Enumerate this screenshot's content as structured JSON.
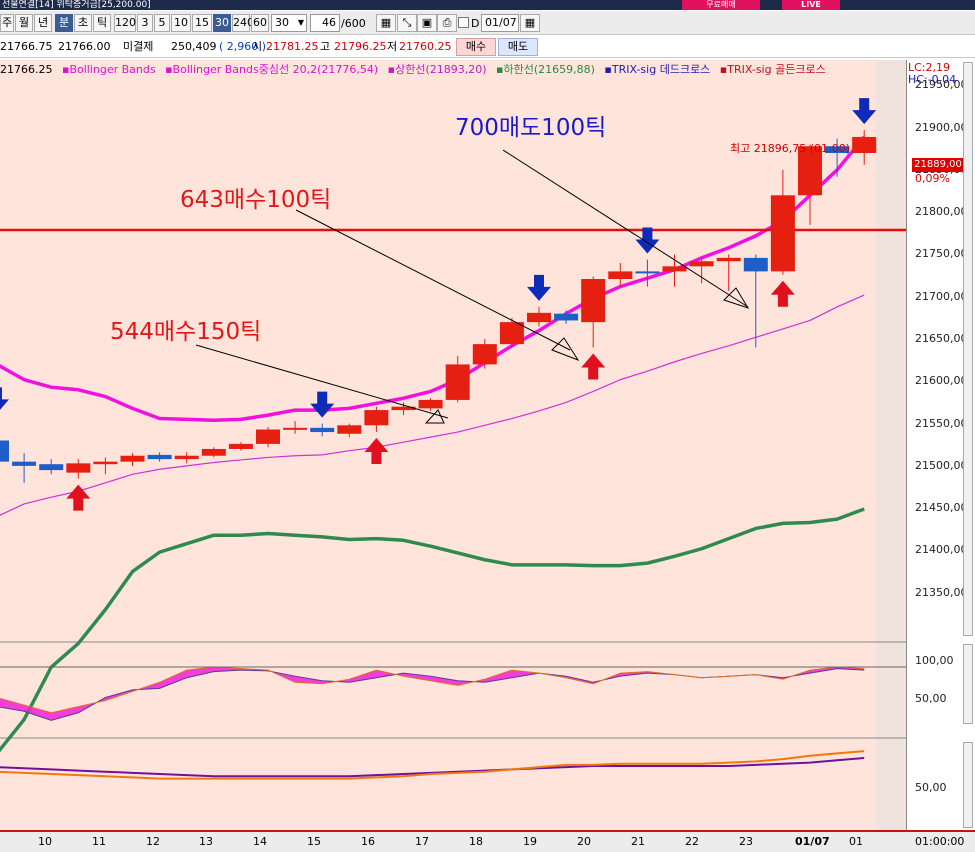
{
  "window": {
    "title": "선물연결[14] 위탁증거금[25,200.00]",
    "badge_buy": "무료매매",
    "badge_live": "LIVE"
  },
  "toolbar": {
    "periods": [
      "주",
      "월",
      "년",
      "분",
      "초",
      "틱"
    ],
    "selected_period": "분",
    "intervals": [
      "120",
      "3",
      "5",
      "10",
      "15",
      "30",
      "240",
      "60"
    ],
    "selected_interval": "30",
    "interval_value": "30",
    "count_value": "46",
    "count_total": "/600",
    "date_value": "01/07"
  },
  "quote": {
    "close": "21766.75",
    "bid": "21766.00",
    "oi_label": "미결제",
    "oi_value": "250,409",
    "oi_change": "( 2,960 )",
    "open_label": "시",
    "open": "21781.25",
    "high_label": "고",
    "high": "21796.25",
    "low_label": "저",
    "low": "21760.25",
    "buy_button": "매수",
    "sell_button": "매도"
  },
  "legend": {
    "value": "21766.25",
    "items": [
      {
        "text": "Bollinger Bands",
        "color": "#e010d0"
      },
      {
        "text": "Bollinger Bands중심선 20,2(21776,54)",
        "color": "#e010d0"
      },
      {
        "text": "상한선(21893,20)",
        "color": "#c020c0"
      },
      {
        "text": "하한선(21659,88)",
        "color": "#2a8a40"
      },
      {
        "text": "TRIX-sig 데드크로스",
        "color": "#1c1cb0"
      },
      {
        "text": "TRIX-sig 골든크로스",
        "color": "#c01020"
      }
    ]
  },
  "right_axis": {
    "lc": "LC:2,19",
    "hc": "HC:-0,04",
    "ticks": [
      "21950,00",
      "21900,00",
      "21850,00",
      "21800,00",
      "21750,00",
      "21700,00",
      "21650,00",
      "21600,00",
      "21550,00",
      "21500,00",
      "21450,00",
      "21400,00",
      "21350,00"
    ],
    "current_price": "21889,00",
    "current_change": "0,09%",
    "sub1_ticks": [
      "100,00",
      "50,00"
    ],
    "sub2_ticks": [
      "50,00"
    ]
  },
  "high_note": "최고 21896,75 (01:00)",
  "annotations": [
    {
      "text": "700매도100틱",
      "color": "#1a1ac8"
    },
    {
      "text": "643매수100틱",
      "color": "#e01818"
    },
    {
      "text": "544매수150틱",
      "color": "#e01818"
    }
  ],
  "x_axis": {
    "labels": [
      "10",
      "11",
      "12",
      "13",
      "14",
      "15",
      "16",
      "17",
      "18",
      "19",
      "20",
      "21",
      "22",
      "23",
      "01/07",
      "01"
    ],
    "time": "01:00:00"
  },
  "chart_data": {
    "type": "candlestick",
    "y_unit": "points",
    "ylim": [
      21300,
      21980
    ],
    "horizontal_line": 21779,
    "candles": [
      {
        "o": 21530,
        "h": 21555,
        "l": 21500,
        "c": 21505,
        "dir": "down"
      },
      {
        "o": 21505,
        "h": 21515,
        "l": 21480,
        "c": 21500,
        "dir": "down"
      },
      {
        "o": 21502,
        "h": 21508,
        "l": 21490,
        "c": 21495,
        "dir": "down"
      },
      {
        "o": 21492,
        "h": 21508,
        "l": 21485,
        "c": 21503,
        "dir": "up"
      },
      {
        "o": 21502,
        "h": 21510,
        "l": 21490,
        "c": 21505,
        "dir": "up"
      },
      {
        "o": 21505,
        "h": 21515,
        "l": 21500,
        "c": 21512,
        "dir": "up"
      },
      {
        "o": 21513,
        "h": 21516,
        "l": 21505,
        "c": 21508,
        "dir": "down"
      },
      {
        "o": 21508,
        "h": 21516,
        "l": 21503,
        "c": 21512,
        "dir": "up"
      },
      {
        "o": 21512,
        "h": 21522,
        "l": 21510,
        "c": 21520,
        "dir": "up"
      },
      {
        "o": 21520,
        "h": 21528,
        "l": 21518,
        "c": 21526,
        "dir": "up"
      },
      {
        "o": 21526,
        "h": 21546,
        "l": 21522,
        "c": 21543,
        "dir": "up"
      },
      {
        "o": 21543,
        "h": 21553,
        "l": 21538,
        "c": 21545,
        "dir": "up"
      },
      {
        "o": 21545,
        "h": 21550,
        "l": 21535,
        "c": 21540,
        "dir": "down"
      },
      {
        "o": 21538,
        "h": 21550,
        "l": 21534,
        "c": 21548,
        "dir": "up"
      },
      {
        "o": 21548,
        "h": 21570,
        "l": 21540,
        "c": 21566,
        "dir": "up"
      },
      {
        "o": 21566,
        "h": 21575,
        "l": 21560,
        "c": 21570,
        "dir": "up"
      },
      {
        "o": 21568,
        "h": 21580,
        "l": 21565,
        "c": 21578,
        "dir": "up"
      },
      {
        "o": 21578,
        "h": 21630,
        "l": 21575,
        "c": 21620,
        "dir": "up"
      },
      {
        "o": 21620,
        "h": 21650,
        "l": 21615,
        "c": 21644,
        "dir": "up"
      },
      {
        "o": 21644,
        "h": 21675,
        "l": 21640,
        "c": 21670,
        "dir": "up"
      },
      {
        "o": 21670,
        "h": 21688,
        "l": 21665,
        "c": 21681,
        "dir": "up"
      },
      {
        "o": 21680,
        "h": 21684,
        "l": 21668,
        "c": 21672,
        "dir": "down"
      },
      {
        "o": 21670,
        "h": 21724,
        "l": 21640,
        "c": 21721,
        "dir": "up"
      },
      {
        "o": 21721,
        "h": 21740,
        "l": 21712,
        "c": 21730,
        "dir": "up"
      },
      {
        "o": 21730,
        "h": 21744,
        "l": 21712,
        "c": 21728,
        "dir": "down"
      },
      {
        "o": 21730,
        "h": 21750,
        "l": 21712,
        "c": 21736,
        "dir": "up"
      },
      {
        "o": 21736,
        "h": 21744,
        "l": 21716,
        "c": 21742,
        "dir": "up"
      },
      {
        "o": 21742,
        "h": 21750,
        "l": 21707,
        "c": 21746,
        "dir": "up"
      },
      {
        "o": 21746,
        "h": 21750,
        "l": 21640,
        "c": 21730,
        "dir": "down"
      },
      {
        "o": 21730,
        "h": 21850,
        "l": 21726,
        "c": 21820,
        "dir": "up"
      },
      {
        "o": 21820,
        "h": 21880,
        "l": 21785,
        "c": 21878,
        "dir": "up"
      },
      {
        "o": 21878,
        "h": 21887,
        "l": 21842,
        "c": 21870,
        "dir": "down"
      },
      {
        "o": 21870,
        "h": 21897,
        "l": 21856,
        "c": 21889,
        "dir": "up"
      }
    ],
    "signals": [
      {
        "bar": 0,
        "type": "sell"
      },
      {
        "bar": 3,
        "type": "buy"
      },
      {
        "bar": 12,
        "type": "sell"
      },
      {
        "bar": 14,
        "type": "buy"
      },
      {
        "bar": 20,
        "type": "sell"
      },
      {
        "bar": 22,
        "type": "buy"
      },
      {
        "bar": 24,
        "type": "sell"
      },
      {
        "bar": 29,
        "type": "buy"
      },
      {
        "bar": 32,
        "type": "sell"
      }
    ],
    "bb_mid": [
      21620,
      21602,
      21593,
      21590,
      21582,
      21568,
      21556,
      21555,
      21554,
      21555,
      21560,
      21566,
      21566,
      21568,
      21574,
      21580,
      21588,
      21602,
      21622,
      21642,
      21660,
      21680,
      21698,
      21712,
      21722,
      21732,
      21746,
      21758,
      21772,
      21790,
      21820,
      21850,
      21889
    ],
    "bb_upper": [
      21440,
      21455,
      21463,
      21470,
      21480,
      21490,
      21496,
      21500,
      21504,
      21507,
      21510,
      21512,
      21513,
      21518,
      21522,
      21528,
      21534,
      21540,
      21548,
      21556,
      21565,
      21575,
      21588,
      21602,
      21612,
      21623,
      21633,
      21642,
      21652,
      21662,
      21672,
      21688,
      21702
    ],
    "bb_lower": [
      21160,
      21200,
      21262,
      21290,
      21330,
      21375,
      21398,
      21408,
      21418,
      21418,
      21420,
      21418,
      21416,
      21413,
      21414,
      21412,
      21405,
      21397,
      21389,
      21383,
      21383,
      21383,
      21382,
      21382,
      21385,
      21393,
      21402,
      21414,
      21426,
      21432,
      21433,
      21437,
      21449
    ],
    "sub1": {
      "ylim": [
        20,
        125
      ],
      "line_a": [
        48,
        42,
        30,
        40,
        60,
        70,
        72,
        86,
        94,
        96,
        95,
        88,
        82,
        80,
        86,
        92,
        88,
        82,
        80,
        86,
        92,
        88,
        80,
        88,
        92,
        90,
        86,
        88,
        90,
        86,
        92,
        98,
        96
      ],
      "line_b": [
        60,
        50,
        40,
        48,
        56,
        68,
        80,
        96,
        100,
        98,
        96,
        80,
        78,
        84,
        96,
        88,
        82,
        76,
        84,
        96,
        92,
        86,
        78,
        92,
        94,
        90,
        86,
        88,
        90,
        84,
        96,
        100,
        98
      ]
    },
    "sub2": {
      "ylim": [
        20,
        90
      ],
      "line_a": [
        68,
        67,
        66,
        65,
        64,
        63,
        62,
        61,
        60,
        60,
        60,
        60,
        60,
        60,
        61,
        62,
        63,
        64,
        65,
        66,
        67,
        68,
        69,
        69,
        69,
        69,
        69,
        69,
        70,
        71,
        72,
        74,
        76
      ],
      "line_b": [
        64,
        63,
        62,
        61,
        60,
        59,
        58,
        58,
        58,
        58,
        58,
        58,
        58,
        58,
        59,
        60,
        62,
        63,
        64,
        66,
        68,
        70,
        70,
        71,
        71,
        71,
        71,
        72,
        73,
        75,
        78,
        80,
        82
      ]
    }
  }
}
